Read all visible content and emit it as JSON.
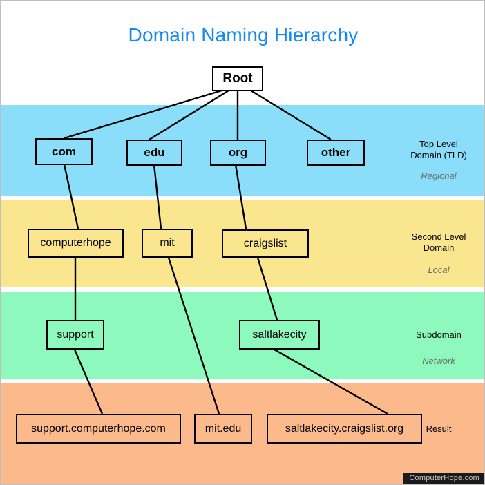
{
  "title": "Domain Naming Hierarchy",
  "title_color": "#1388F2",
  "watermark": "ComputerHope.com",
  "bands": {
    "tld": {
      "label_line1": "Top Level",
      "label_line2": "Domain (TLD)",
      "sublabel": "Regional",
      "color": "#8ADEF9"
    },
    "sld": {
      "label_line1": "Second Level",
      "label_line2": "Domain",
      "sublabel": "Local",
      "color": "#FAE68E"
    },
    "sub": {
      "label_line1": "Subdomain",
      "label_line2": "",
      "sublabel": "Network",
      "color": "#8DF9BC"
    },
    "result": {
      "label_line1": "Result",
      "label_line2": "",
      "sublabel": "",
      "color": "#FCB98B"
    }
  },
  "nodes": {
    "root": "Root",
    "tld": [
      "com",
      "edu",
      "org",
      "other"
    ],
    "second_level": [
      "computerhope",
      "mit",
      "craigslist"
    ],
    "subdomain": [
      "support",
      "saltlakecity"
    ],
    "results": [
      "support.computerhope.com",
      "mit.edu",
      "saltlakecity.craigslist.org"
    ]
  },
  "chart_data": {
    "type": "diagram",
    "diagram_kind": "tree-hierarchy",
    "title": "Domain Naming Hierarchy",
    "levels": [
      {
        "name": "Root",
        "band_color": "#ffffff",
        "nodes": [
          "Root"
        ]
      },
      {
        "name": "Top Level Domain (TLD)",
        "scope": "Regional",
        "band_color": "#8ADEF9",
        "nodes": [
          "com",
          "edu",
          "org",
          "other"
        ]
      },
      {
        "name": "Second Level Domain",
        "scope": "Local",
        "band_color": "#FAE68E",
        "nodes": [
          "computerhope",
          "mit",
          "craigslist"
        ]
      },
      {
        "name": "Subdomain",
        "scope": "Network",
        "band_color": "#8DF9BC",
        "nodes": [
          "support",
          "saltlakecity"
        ]
      },
      {
        "name": "Result",
        "scope": "",
        "band_color": "#FCB98B",
        "nodes": [
          "support.computerhope.com",
          "mit.edu",
          "saltlakecity.craigslist.org"
        ]
      }
    ],
    "edges": [
      [
        "Root",
        "com"
      ],
      [
        "Root",
        "edu"
      ],
      [
        "Root",
        "org"
      ],
      [
        "Root",
        "other"
      ],
      [
        "com",
        "computerhope"
      ],
      [
        "edu",
        "mit"
      ],
      [
        "org",
        "craigslist"
      ],
      [
        "computerhope",
        "support"
      ],
      [
        "craigslist",
        "saltlakecity"
      ],
      [
        "support",
        "support.computerhope.com"
      ],
      [
        "mit",
        "mit.edu"
      ],
      [
        "saltlakecity",
        "saltlakecity.craigslist.org"
      ]
    ]
  }
}
